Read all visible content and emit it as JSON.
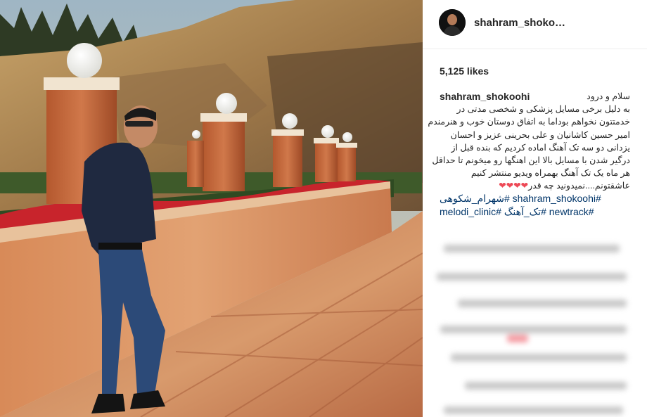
{
  "post": {
    "username": "shahram_shoko…",
    "likes": "5,125 likes",
    "caption": {
      "author": "shahram_shokoohi",
      "lines": [
        "سلام و درود",
        "به دلیل برخی مسایل پزشکی و شخصی مدتی در",
        "خدمتتون نخواهم بوداما به اتفاق دوستان خوب و هنرمندم",
        "امیر حسین کاشانیان و علی بحرینی عزیز و احسان",
        "یزدانی دو سه تک آهنگ اماده کردیم که بنده قبل از",
        "درگیر شدن با مسایل بالا این اهنگها رو میخونم تا حداقل",
        "هر ماه یک تک آهنگ بهمراه ویدیو منتشر کنیم",
        "عاشقتونم....نمیدونید چه قدر"
      ],
      "hearts": "❤❤❤❤",
      "hashtags": [
        "شهرام_شکوهی# shahram_shokoohi#",
        "melodi_clinic# تک_آهنگ# newtrack#"
      ]
    },
    "colors": {
      "link": "#003569",
      "heart": "#ed4956",
      "divider": "#efefef"
    }
  }
}
